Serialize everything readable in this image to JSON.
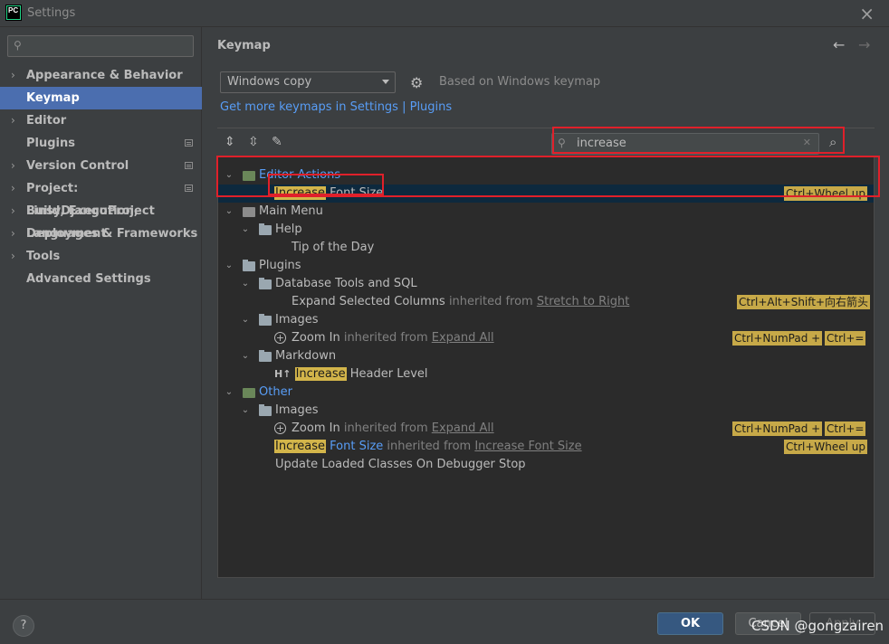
{
  "window": {
    "title": "Settings",
    "app_icon": "PC"
  },
  "sidebar": {
    "search_placeholder": "",
    "items": [
      {
        "label": "Appearance & Behavior",
        "expandable": true,
        "marker": false
      },
      {
        "label": "Keymap",
        "expandable": false,
        "selected": true,
        "marker": false
      },
      {
        "label": "Editor",
        "expandable": true,
        "marker": false
      },
      {
        "label": "Plugins",
        "expandable": false,
        "marker": true
      },
      {
        "label": "Version Control",
        "expandable": true,
        "marker": true
      },
      {
        "label": "Project: LinsyDjangoProject",
        "expandable": true,
        "marker": true
      },
      {
        "label": "Build, Execution, Deployment",
        "expandable": true,
        "marker": false
      },
      {
        "label": "Languages & Frameworks",
        "expandable": true,
        "marker": false
      },
      {
        "label": "Tools",
        "expandable": true,
        "marker": false
      },
      {
        "label": "Advanced Settings",
        "expandable": false,
        "marker": false
      }
    ]
  },
  "main": {
    "breadcrumb": "Keymap",
    "keymap_select": "Windows copy",
    "based_on": "Based on Windows keymap",
    "get_more_text": "Get more keymaps in Settings | Plugins",
    "search_value": "increase"
  },
  "tree": {
    "editor_actions": "Editor Actions",
    "increase_font_size_hl": "Increase",
    "increase_font_size_rest": " Font Size",
    "ctrl_wheel_up": "Ctrl+Wheel up",
    "main_menu": "Main Menu",
    "help": "Help",
    "tip_of_day": "Tip of the Day",
    "plugins": "Plugins",
    "db_tools": "Database Tools and SQL",
    "expand_selected": "Expand Selected Columns",
    "inherited_from": "inherited from",
    "stretch_to_right": "Stretch to Right",
    "ctrl_alt_shift_right": "Ctrl+Alt+Shift+向右箭头",
    "images": "Images",
    "zoom_in": "Zoom In",
    "expand_all": "Expand All",
    "ctrl_numpad_plus": "Ctrl+NumPad +",
    "ctrl_eq": "Ctrl+=",
    "markdown": "Markdown",
    "header_prefix": "H↑",
    "increase_hl": "Increase",
    "header_level_rest": " Header Level",
    "other": "Other",
    "images2": "Images",
    "zoom_in2": "Zoom In",
    "expand_all2": "Expand All",
    "ctrl_numpad_plus2": "Ctrl+NumPad +",
    "ctrl_eq2": "Ctrl+=",
    "increase_hl2": "Increase",
    "font_size_blue": " Font Size",
    "inherited_from2": "inherited from",
    "increase_font_size_link": "Increase Font Size",
    "ctrl_wheel_up2": "Ctrl+Wheel up",
    "update_loaded": "Update Loaded Classes On Debugger Stop"
  },
  "footer": {
    "help": "?",
    "ok": "OK",
    "cancel": "Cancel",
    "apply": "Apply",
    "watermark": "CSDN @gongzairen"
  },
  "colors": {
    "accent": "#4b6eaf",
    "highlight": "#d3b54a",
    "annotation": "#e0202a",
    "link": "#589df6"
  }
}
